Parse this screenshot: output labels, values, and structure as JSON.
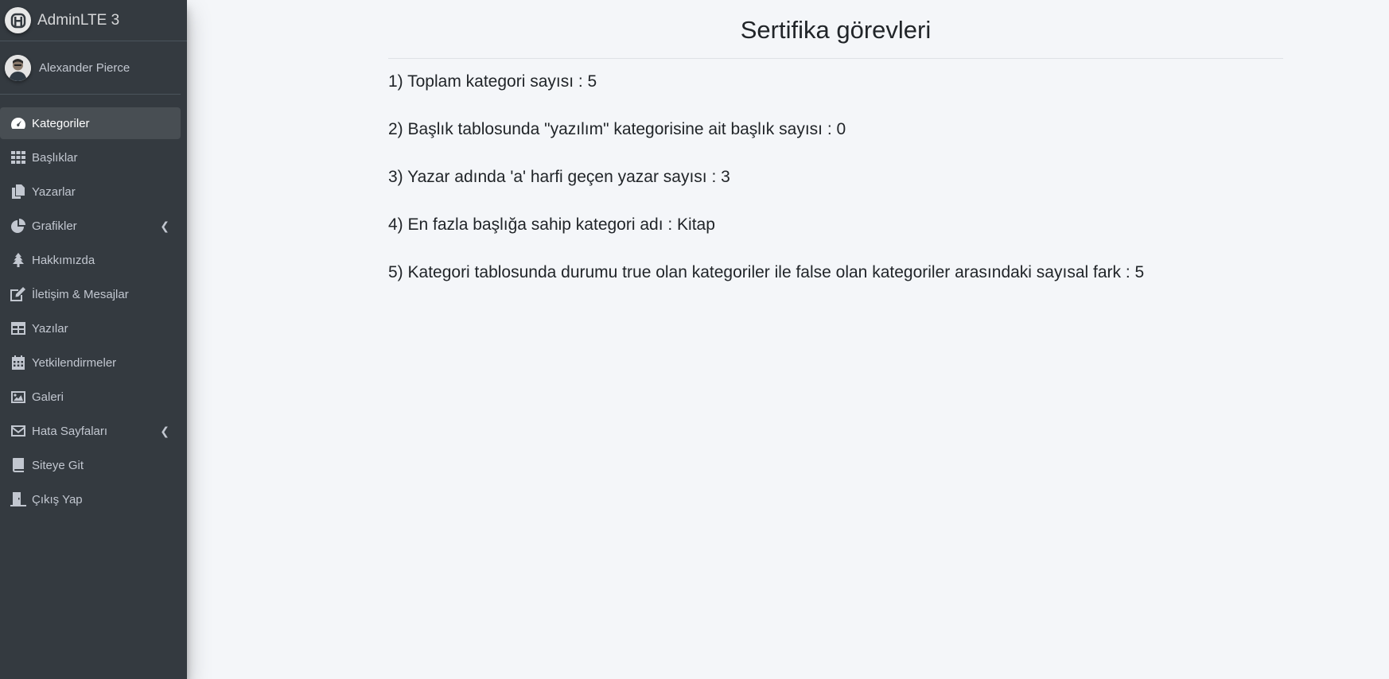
{
  "brand": {
    "name": "AdminLTE 3"
  },
  "user": {
    "name": "Alexander Pierce"
  },
  "sidebar": {
    "items": [
      {
        "label": "Kategoriler",
        "icon": "tachometer-icon",
        "active": true
      },
      {
        "label": "Başlıklar",
        "icon": "grid-icon"
      },
      {
        "label": "Yazarlar",
        "icon": "copy-icon"
      },
      {
        "label": "Grafikler",
        "icon": "pie-chart-icon",
        "chevron": true
      },
      {
        "label": "Hakkımızda",
        "icon": "tree-icon"
      },
      {
        "label": "İletişim & Mesajlar",
        "icon": "edit-icon"
      },
      {
        "label": "Yazılar",
        "icon": "table-icon"
      },
      {
        "label": "Yetkilendirmeler",
        "icon": "calendar-icon"
      },
      {
        "label": "Galeri",
        "icon": "image-icon"
      },
      {
        "label": "Hata Sayfaları",
        "icon": "envelope-icon",
        "chevron": true
      },
      {
        "label": "Siteye Git",
        "icon": "book-icon"
      },
      {
        "label": "Çıkış Yap",
        "icon": "door-icon"
      }
    ]
  },
  "main": {
    "title": "Sertifika görevleri",
    "tasks": [
      "1) Toplam kategori sayısı : 5",
      "2) Başlık tablosunda \"yazılım\" kategorisine ait başlık sayısı : 0",
      "3) Yazar adında 'a' harfi geçen yazar sayısı : 3",
      "4) En fazla başlığa sahip kategori adı : Kitap",
      "5) Kategori tablosunda durumu true olan kategoriler ile false olan kategoriler arasındaki sayısal fark : 5"
    ]
  }
}
